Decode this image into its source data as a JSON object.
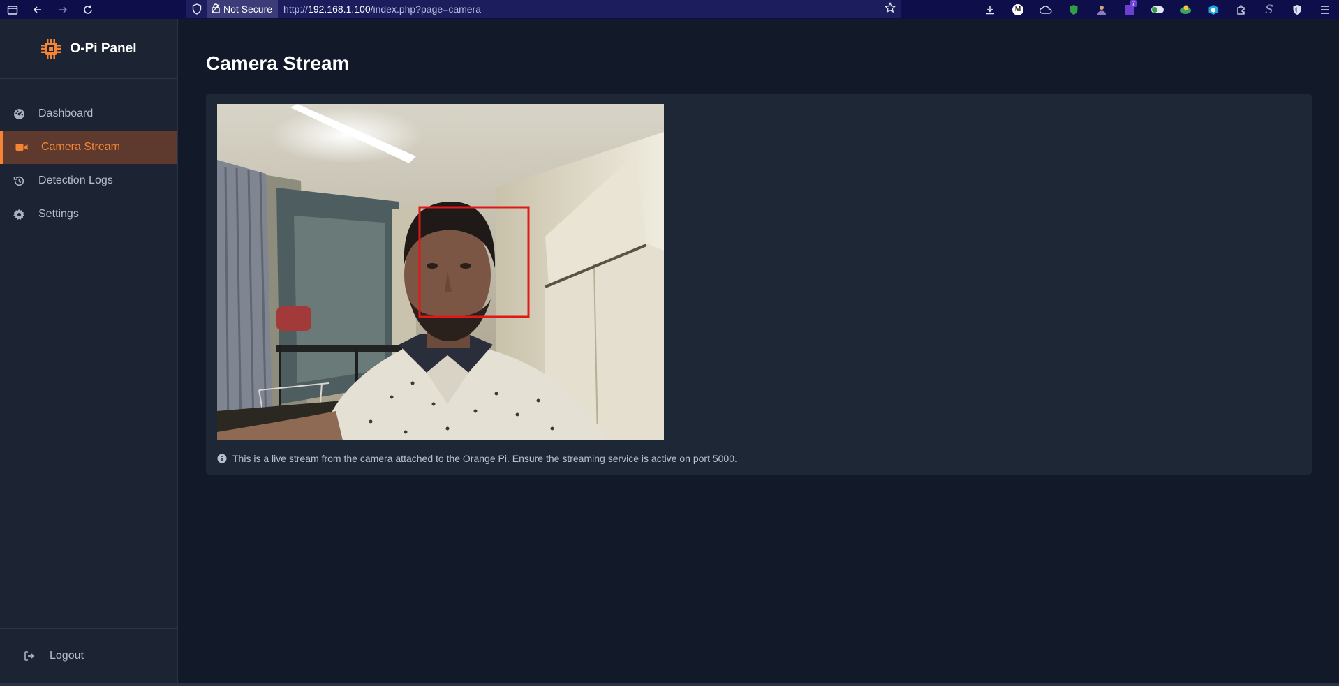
{
  "browser": {
    "security_label": "Not Secure",
    "url_prefix": "http://",
    "url_host": "192.168.1.100",
    "url_path": "/index.php?page=camera",
    "extensions": [
      "download-icon",
      "m-extension-icon",
      "cloud-extension-icon",
      "shield-green-extension-icon",
      "person-extension-icon",
      "purple-extension-icon",
      "toggle-extension-icon",
      "globe-extension-icon",
      "cube-extension-icon",
      "puzzle-icon",
      "s-extension-icon",
      "shield-extension-icon",
      "menu-icon"
    ],
    "badge_count": "7"
  },
  "sidebar": {
    "brand": "O-Pi Panel",
    "brand_icon": "cpu-chip-icon",
    "brand_color": "#f58535",
    "items": [
      {
        "label": "Dashboard",
        "icon": "gauge-icon",
        "active": false
      },
      {
        "label": "Camera Stream",
        "icon": "video-camera-icon",
        "active": true
      },
      {
        "label": "Detection Logs",
        "icon": "history-icon",
        "active": false
      },
      {
        "label": "Settings",
        "icon": "gear-icon",
        "active": false
      }
    ],
    "logout_label": "Logout"
  },
  "main": {
    "title": "Camera Stream",
    "info_text": "This is a live stream from the camera attached to the Orange Pi. Ensure the streaming service is active on port 5000.",
    "detection_box_color": "#e01818"
  }
}
